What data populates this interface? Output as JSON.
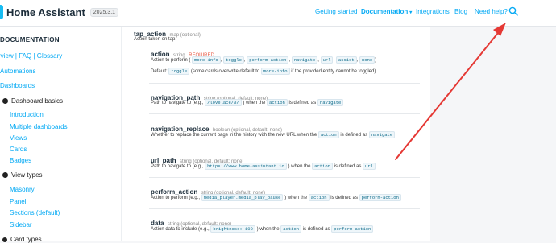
{
  "header": {
    "brand": "Home Assistant",
    "version": "2025.3.1",
    "nav": [
      {
        "label": "Getting started",
        "bold": false
      },
      {
        "label": "Documentation",
        "bold": true
      },
      {
        "label": "Integrations",
        "bold": false
      },
      {
        "label": "Blog",
        "bold": false
      },
      {
        "label": "Need help?",
        "bold": false
      }
    ],
    "search_icon": "search-icon"
  },
  "sidebar": {
    "heading": "DOCUMENTATION",
    "quicklinks": "rview | FAQ | Glossary",
    "automations": "Automations",
    "dashboards": "Dashboards",
    "dashboard_basics": "Dashboard basics",
    "basics_items": [
      "Introduction",
      "Multiple dashboards",
      "Views",
      "Cards",
      "Badges"
    ],
    "view_types": "View types",
    "view_items": [
      "Masonry",
      "Panel",
      "Sections (default)",
      "Sidebar"
    ],
    "card_types": "Card types"
  },
  "content": {
    "tap_action": {
      "name": "tap_action",
      "type": "map (optional)",
      "desc": "Action taken on tap."
    },
    "action": {
      "name": "action",
      "type": "string",
      "required": "REQUIRED",
      "desc_prefix": "Action to perform (",
      "codes": [
        "more-info",
        "toggle",
        "perform-action",
        "navigate",
        "url",
        "assist",
        "none"
      ],
      "desc_suffix": ")",
      "default_label": "Default:",
      "default_code": "toggle",
      "default_mid": "(some cards overwrite default to",
      "default_code2": "more-info",
      "default_end": "if the provided entity cannot be toggled)"
    },
    "navigation_path": {
      "name": "navigation_path",
      "type": "string (optional, default: none)",
      "desc_a": "Path to navigate to (e.g.,",
      "code_a": "/lovelace/0/",
      "desc_b": ") when the",
      "code_b": "action",
      "desc_c": "is defined as",
      "code_c": "navigate"
    },
    "navigation_replace": {
      "name": "navigation_replace",
      "type": "boolean (optional, default: none)",
      "desc_a": "Whether to replace the current page in the history with the new URL when the",
      "code_b": "action",
      "desc_c": "is defined as",
      "code_c": "navigate"
    },
    "url_path": {
      "name": "url_path",
      "type": "string (optional, default: none)",
      "desc_a": "Path to navigate to (e.g.,",
      "code_a": "https://www.home-assistant.io",
      "desc_b": ") when the",
      "code_b": "action",
      "desc_c": "is defined as",
      "code_c": "url"
    },
    "perform_action": {
      "name": "perform_action",
      "type": "string (optional, default: none)",
      "desc_a": "Action to perform (e.g.,",
      "code_a": "media_player.media_play_pause",
      "desc_b": ") when the",
      "code_b": "action",
      "desc_c": "is defined as",
      "code_c": "perform-action"
    },
    "data": {
      "name": "data",
      "type": "string (optional, default: none)",
      "desc_a": "Action data to include (e.g.,",
      "code_a": "brightness: 100",
      "desc_b": ") when the",
      "code_b": "action",
      "desc_c": "is defined as",
      "code_c": "perform-action"
    }
  },
  "colors": {
    "accent": "#03a9f4",
    "arrow": "#e53935",
    "required": "#e8553f"
  }
}
